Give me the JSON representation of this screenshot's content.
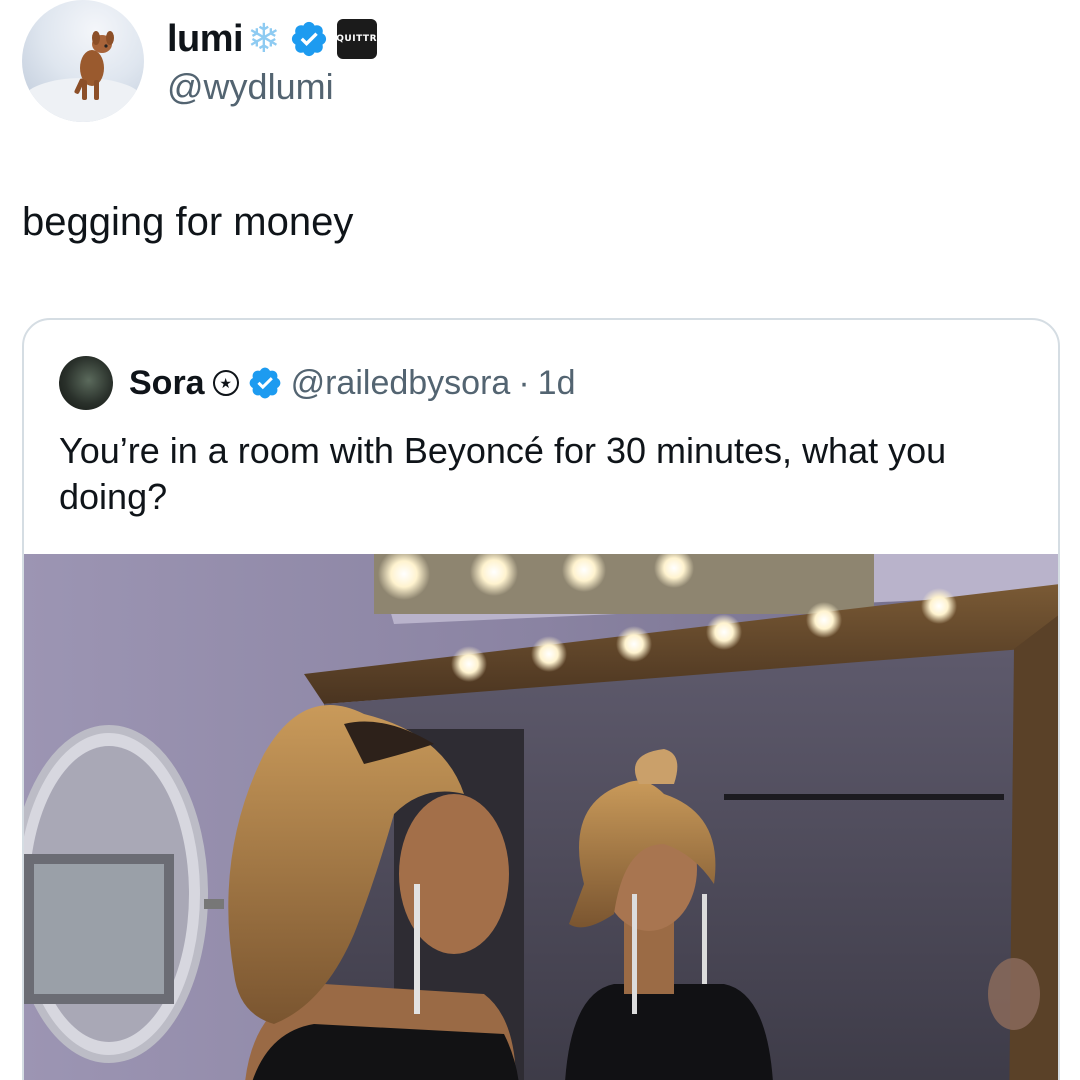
{
  "tweet": {
    "author": {
      "display_name": "lumi",
      "handle": "@wydlumi",
      "emoji_icon": "snowflake-icon",
      "verified": true,
      "affiliate_badge_text": "QUITTR"
    },
    "text": "begging for money"
  },
  "quoted_tweet": {
    "author": {
      "display_name": "Sora",
      "handle": "@railedbysora",
      "automated_icon": "bot-badge-icon",
      "verified": true
    },
    "separator": "·",
    "time": "1d",
    "text": "You’re in a room with Beyoncé for 30 minutes, what you doing?",
    "media": "photo"
  },
  "colors": {
    "verified_blue": "#1d9bf0",
    "text_primary": "#0f1419",
    "text_secondary": "#536471",
    "card_border": "#d5dde3"
  }
}
